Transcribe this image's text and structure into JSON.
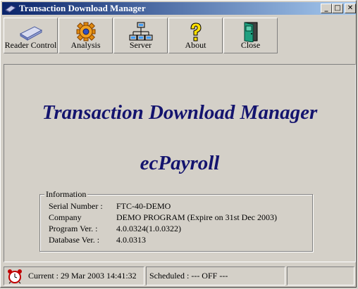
{
  "window": {
    "title": "Transaction Download Manager"
  },
  "caption_buttons": {
    "minimize": "_",
    "maximize": "□",
    "close": "✕"
  },
  "toolbar": {
    "buttons": [
      {
        "label": "Reader Control",
        "icon": "card-reader-icon"
      },
      {
        "label": "Analysis",
        "icon": "gear-icon"
      },
      {
        "label": "Server",
        "icon": "network-icon"
      },
      {
        "label": "About",
        "icon": "help-icon"
      },
      {
        "label": "Close",
        "icon": "door-icon"
      }
    ]
  },
  "main": {
    "app_title": "Transaction Download Manager",
    "product": "ecPayroll",
    "info": {
      "legend": "Information",
      "rows": [
        {
          "key": "Serial Number :",
          "value": "FTC-40-DEMO"
        },
        {
          "key": "Company",
          "value": "DEMO PROGRAM (Expire on 31st Dec 2003)"
        },
        {
          "key": "Program Ver.  :",
          "value": "4.0.0324(1.0.0322)"
        },
        {
          "key": "Database Ver.  :",
          "value": "4.0.0313"
        }
      ]
    }
  },
  "status": {
    "current": "Current : 29 Mar 2003 14:41:32",
    "scheduled": "Scheduled : --- OFF ---",
    "extra": ""
  }
}
